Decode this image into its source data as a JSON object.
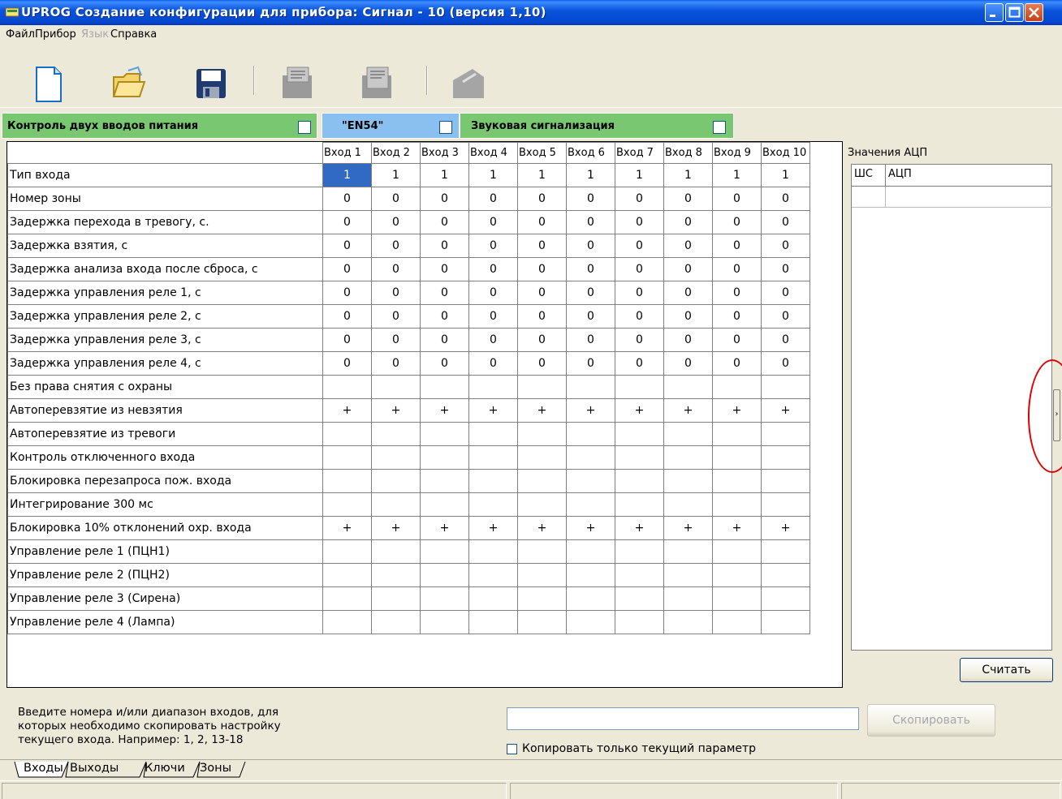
{
  "window": {
    "title": "UPROG  Создание конфигурации для прибора: Сигнал - 10 (версия  1,10)",
    "colors": {
      "titlebar": "#0a55dc",
      "green_option": "#79c871",
      "blue_option": "#8ac0f0",
      "selection": "#316ac5",
      "annotation": "#e00000"
    }
  },
  "menu": [
    "Файл",
    "Прибор",
    "Язык",
    "Справка"
  ],
  "toolbar": {
    "buttons": [
      "new-file-icon",
      "open-folder-icon",
      "save-disk-icon",
      "read-config-icon",
      "write-config-icon",
      "erase-icon"
    ]
  },
  "options": {
    "power_control": "Контроль двух вводов питания",
    "en54": "\"EN54\"",
    "sound_alarm": "Звуковая сигнализация"
  },
  "grid": {
    "columns": [
      "Вход 1",
      "Вход 2",
      "Вход 3",
      "Вход 4",
      "Вход 5",
      "Вход 6",
      "Вход 7",
      "Вход 8",
      "Вход 9",
      "Вход 10"
    ],
    "rows": [
      {
        "label": "Тип входа",
        "values": [
          "1",
          "1",
          "1",
          "1",
          "1",
          "1",
          "1",
          "1",
          "1",
          "1"
        ]
      },
      {
        "label": "Номер зоны",
        "values": [
          "0",
          "0",
          "0",
          "0",
          "0",
          "0",
          "0",
          "0",
          "0",
          "0"
        ]
      },
      {
        "label": "Задержка перехода в тревогу, с.",
        "values": [
          "0",
          "0",
          "0",
          "0",
          "0",
          "0",
          "0",
          "0",
          "0",
          "0"
        ]
      },
      {
        "label": "Задержка взятия, с",
        "values": [
          "0",
          "0",
          "0",
          "0",
          "0",
          "0",
          "0",
          "0",
          "0",
          "0"
        ]
      },
      {
        "label": "Задержка анализа входа после сброса, с",
        "values": [
          "0",
          "0",
          "0",
          "0",
          "0",
          "0",
          "0",
          "0",
          "0",
          "0"
        ]
      },
      {
        "label": "Задержка управления реле 1, с",
        "values": [
          "0",
          "0",
          "0",
          "0",
          "0",
          "0",
          "0",
          "0",
          "0",
          "0"
        ]
      },
      {
        "label": "Задержка управления реле 2, с",
        "values": [
          "0",
          "0",
          "0",
          "0",
          "0",
          "0",
          "0",
          "0",
          "0",
          "0"
        ]
      },
      {
        "label": "Задержка управления реле 3, с",
        "values": [
          "0",
          "0",
          "0",
          "0",
          "0",
          "0",
          "0",
          "0",
          "0",
          "0"
        ]
      },
      {
        "label": "Задержка управления реле 4, с",
        "values": [
          "0",
          "0",
          "0",
          "0",
          "0",
          "0",
          "0",
          "0",
          "0",
          "0"
        ]
      },
      {
        "label": "Без права снятия с охраны",
        "values": [
          "",
          "",
          "",
          "",
          "",
          "",
          "",
          "",
          "",
          ""
        ]
      },
      {
        "label": "Автоперевзятие из невзятия",
        "values": [
          "+",
          "+",
          "+",
          "+",
          "+",
          "+",
          "+",
          "+",
          "+",
          "+"
        ]
      },
      {
        "label": "Автоперевзятие из тревоги",
        "values": [
          "",
          "",
          "",
          "",
          "",
          "",
          "",
          "",
          "",
          ""
        ]
      },
      {
        "label": "Контроль отключенного входа",
        "values": [
          "",
          "",
          "",
          "",
          "",
          "",
          "",
          "",
          "",
          ""
        ]
      },
      {
        "label": "Блокировка перезапроса пож. входа",
        "values": [
          "",
          "",
          "",
          "",
          "",
          "",
          "",
          "",
          "",
          ""
        ]
      },
      {
        "label": "Интегрирование 300 мс",
        "values": [
          "",
          "",
          "",
          "",
          "",
          "",
          "",
          "",
          "",
          ""
        ]
      },
      {
        "label": "Блокировка 10% отклонений охр. входа",
        "values": [
          "+",
          "+",
          "+",
          "+",
          "+",
          "+",
          "+",
          "+",
          "+",
          "+"
        ]
      },
      {
        "label": "Управление реле 1 (ПЦН1)",
        "values": [
          "",
          "",
          "",
          "",
          "",
          "",
          "",
          "",
          "",
          ""
        ]
      },
      {
        "label": "Управление реле 2 (ПЦН2)",
        "values": [
          "",
          "",
          "",
          "",
          "",
          "",
          "",
          "",
          "",
          ""
        ]
      },
      {
        "label": "Управление реле 3 (Сирена)",
        "values": [
          "",
          "",
          "",
          "",
          "",
          "",
          "",
          "",
          "",
          ""
        ]
      },
      {
        "label": "Управление реле 4 (Лампа)",
        "values": [
          "",
          "",
          "",
          "",
          "",
          "",
          "",
          "",
          "",
          ""
        ]
      }
    ]
  },
  "adc": {
    "title": "Значения АЦП",
    "col_shs": "ШС",
    "col_adc": "АЦП",
    "read_button": "Считать"
  },
  "copy": {
    "hint": "Введите номера и/или диапазон входов, для которых необходимо скопировать настройку текущего входа. Например: 1, 2, 13-18",
    "input_value": "",
    "button": "Скопировать",
    "only_current": "Копировать только текущий параметр"
  },
  "tabs": [
    "Входы",
    "Выходы",
    "Ключи",
    "Зоны"
  ]
}
